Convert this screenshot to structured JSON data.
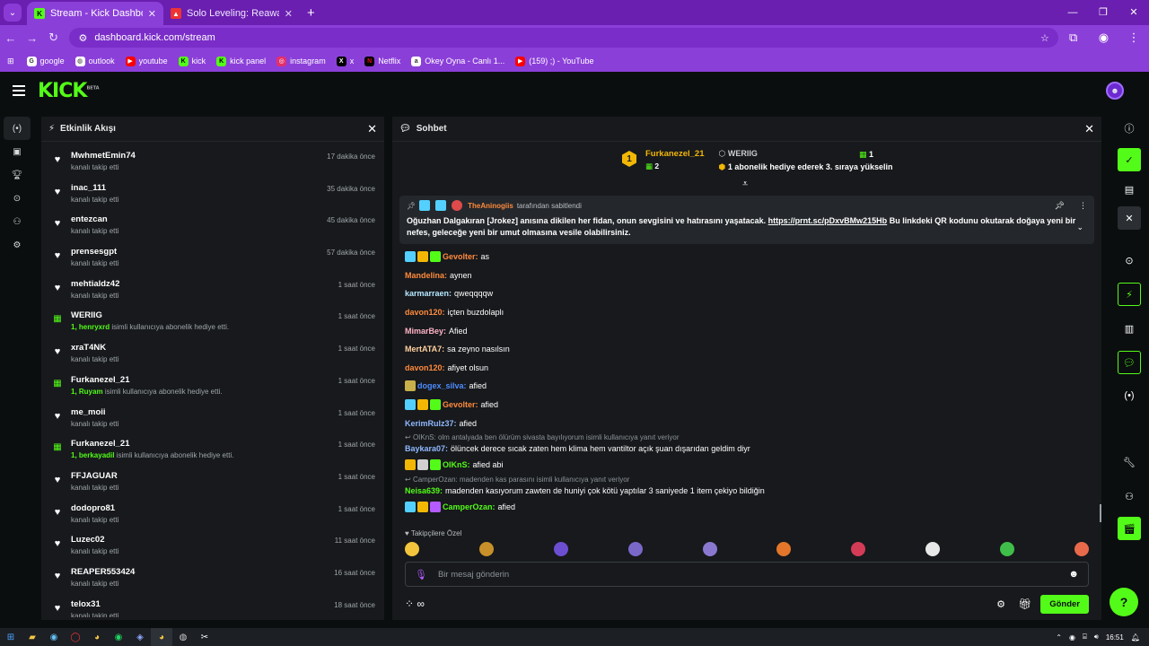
{
  "browser": {
    "tabs": [
      {
        "title": "Stream - Kick Dashboard",
        "active": true
      },
      {
        "title": "Solo Leveling: Reawakening - G",
        "active": false
      }
    ],
    "url": "dashboard.kick.com/stream",
    "bookmarks": [
      "google",
      "outlook",
      "youtube",
      "kick",
      "kick panel",
      "instagram",
      "x",
      "Netflix",
      "Okey Oyna - Canlı 1...",
      "(159) ;) - YouTube"
    ]
  },
  "kick": {
    "logo": "KICK",
    "logo_sup": "BETA"
  },
  "activity": {
    "title": "Etkinlik Akışı",
    "items": [
      {
        "type": "follow",
        "name": "MwhmetEmin74",
        "sub": "kanalı takip etti",
        "time": "17 dakika önce"
      },
      {
        "type": "follow",
        "name": "inac_111",
        "sub": "kanalı takip etti",
        "time": "35 dakika önce"
      },
      {
        "type": "follow",
        "name": "entezcan",
        "sub": "kanalı takip etti",
        "time": "45 dakika önce"
      },
      {
        "type": "follow",
        "name": "prensesgpt",
        "sub": "kanalı takip etti",
        "time": "57 dakika önce"
      },
      {
        "type": "follow",
        "name": "mehtialdz42",
        "sub": "kanalı takip etti",
        "time": "1 saat önce"
      },
      {
        "type": "gift",
        "name": "WERIIG",
        "gift_to": "1, henryxrd",
        "sub": "isimli kullanıcıya abonelik hediye etti.",
        "time": "1 saat önce"
      },
      {
        "type": "follow",
        "name": "xraT4NK",
        "sub": "kanalı takip etti",
        "time": "1 saat önce"
      },
      {
        "type": "gift",
        "name": "Furkanezel_21",
        "gift_to": "1, Ruyam",
        "sub": "isimli kullanıcıya abonelik hediye etti.",
        "time": "1 saat önce"
      },
      {
        "type": "follow",
        "name": "me_moii",
        "sub": "kanalı takip etti",
        "time": "1 saat önce"
      },
      {
        "type": "gift",
        "name": "Furkanezel_21",
        "gift_to": "1, berkayadil",
        "sub": "isimli kullanıcıya abonelik hediye etti.",
        "time": "1 saat önce"
      },
      {
        "type": "follow",
        "name": "FFJAGUAR",
        "sub": "kanalı takip etti",
        "time": "1 saat önce"
      },
      {
        "type": "follow",
        "name": "dodopro81",
        "sub": "kanalı takip etti",
        "time": "1 saat önce"
      },
      {
        "type": "follow",
        "name": "Luzec02",
        "sub": "kanalı takip etti",
        "time": "11 saat önce"
      },
      {
        "type": "follow",
        "name": "REAPER553424",
        "sub": "kanalı takip etti",
        "time": "16 saat önce"
      },
      {
        "type": "follow",
        "name": "telox31",
        "sub": "kanalı takip etti",
        "time": "18 saat önce"
      }
    ]
  },
  "chat": {
    "title": "Sohbet",
    "goal": {
      "leader_rank": "1",
      "leader_name": "Furkanezel_21",
      "leader_count": "2",
      "second_name": "WERIIG",
      "second_msg": "1 abonelik hediye ederek 3. sıraya yükselin",
      "second_count": "1"
    },
    "pinned": {
      "author": "TheAninogiis",
      "label": "tarafından sabitlendi",
      "text": "Oğuzhan Dalgakıran [Jrokez] anısına dikilen her fidan, onun sevgisini ve hatırasını yaşatacak.",
      "link": "https://prnt.sc/pDxvBMw215Hb",
      "text2": "Bu linkdeki QR kodunu okutarak doğaya yeni bir nefes, geleceğe yeni bir umut olmasına vesile olabilirsiniz."
    },
    "messages": [
      {
        "user": "Gevolter",
        "color": "#ff8a3d",
        "text": "as",
        "badges": [
          "#53d0ff",
          "#f2b705",
          "#53fc18"
        ]
      },
      {
        "user": "Mandelina",
        "color": "#ff8a3d",
        "text": "aynen"
      },
      {
        "user": "karmarraen",
        "color": "#b5e8ff",
        "text": "qweqqqqw"
      },
      {
        "user": "davon120",
        "color": "#ff8a3d",
        "text": "içten buzdolaplı"
      },
      {
        "user": "MimarBey",
        "color": "#ffb3c6",
        "text": "Afied"
      },
      {
        "user": "MertATA7",
        "color": "#ffd0a0",
        "text": "sa zeyno nasılsın"
      },
      {
        "user": "davon120",
        "color": "#ff8a3d",
        "text": "afiyet olsun"
      },
      {
        "user": "dogex_silva",
        "color": "#4e8cff",
        "text": "afied",
        "badges": [
          "#c8b04a"
        ]
      },
      {
        "user": "Gevolter",
        "color": "#ff8a3d",
        "text": "afied",
        "badges": [
          "#53d0ff",
          "#f2b705",
          "#53fc18"
        ]
      },
      {
        "user": "KerimRulz37",
        "color": "#8fb8ff",
        "text": "afied"
      },
      {
        "reply": "OIKnS: olm antalyada ben ölürüm sivasta bayılıyorum isimli kullanıcıya yanıt veriyor"
      },
      {
        "user": "Baykara07",
        "color": "#8fb8ff",
        "text": "ölüncek derece sıcak zaten hem klima hem vantiltor açık şuan dışarıdan geldim diyr"
      },
      {
        "user": "OIKnS",
        "color": "#53fc18",
        "text": "afied abi",
        "badges": [
          "#f2b705",
          "#d0d0d0",
          "#53fc18"
        ]
      },
      {
        "reply": "CamperOzan: madenden kas parasını isimli kullanıcıya yanıt veriyor"
      },
      {
        "user": "Neisa639",
        "color": "#53fc18",
        "text": "madenden kasıyorum zawten de huniyi çok kötü yaptılar 3 saniyede 1 item çekiyo bildiğin"
      },
      {
        "user": "CamperOzan",
        "color": "#53fc18",
        "text": "afied",
        "badges": [
          "#53d0ff",
          "#f2b705",
          "#b45cff"
        ]
      }
    ],
    "followers_label": "Takipçilere Özel",
    "input_placeholder": "Bir mesaj gönderin",
    "send_label": "Gönder"
  },
  "taskbar": {
    "time": "16:51"
  },
  "colors": {
    "brand": "#53fc18",
    "chrome": "#8b3fd9"
  }
}
